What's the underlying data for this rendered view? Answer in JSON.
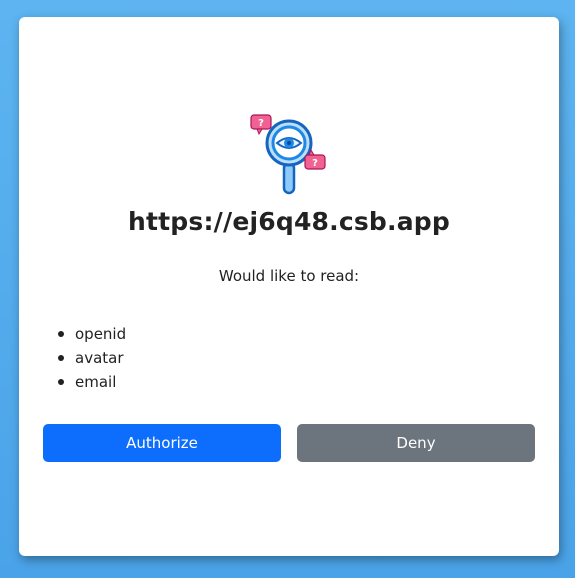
{
  "dialog": {
    "app_name": "https://ej6q48.csb.app",
    "prompt": "Would like to read:",
    "scopes": [
      "openid",
      "avatar",
      "email"
    ],
    "authorize_label": "Authorize",
    "deny_label": "Deny",
    "logo_icon": "magnifier-eye-icon",
    "logo_badge_text": "?"
  },
  "colors": {
    "background": "#4aa6ea",
    "authorize": "#0d6efd",
    "deny": "#6c757d",
    "logo_blue": "#1e88e5",
    "logo_pink": "#f06292"
  }
}
